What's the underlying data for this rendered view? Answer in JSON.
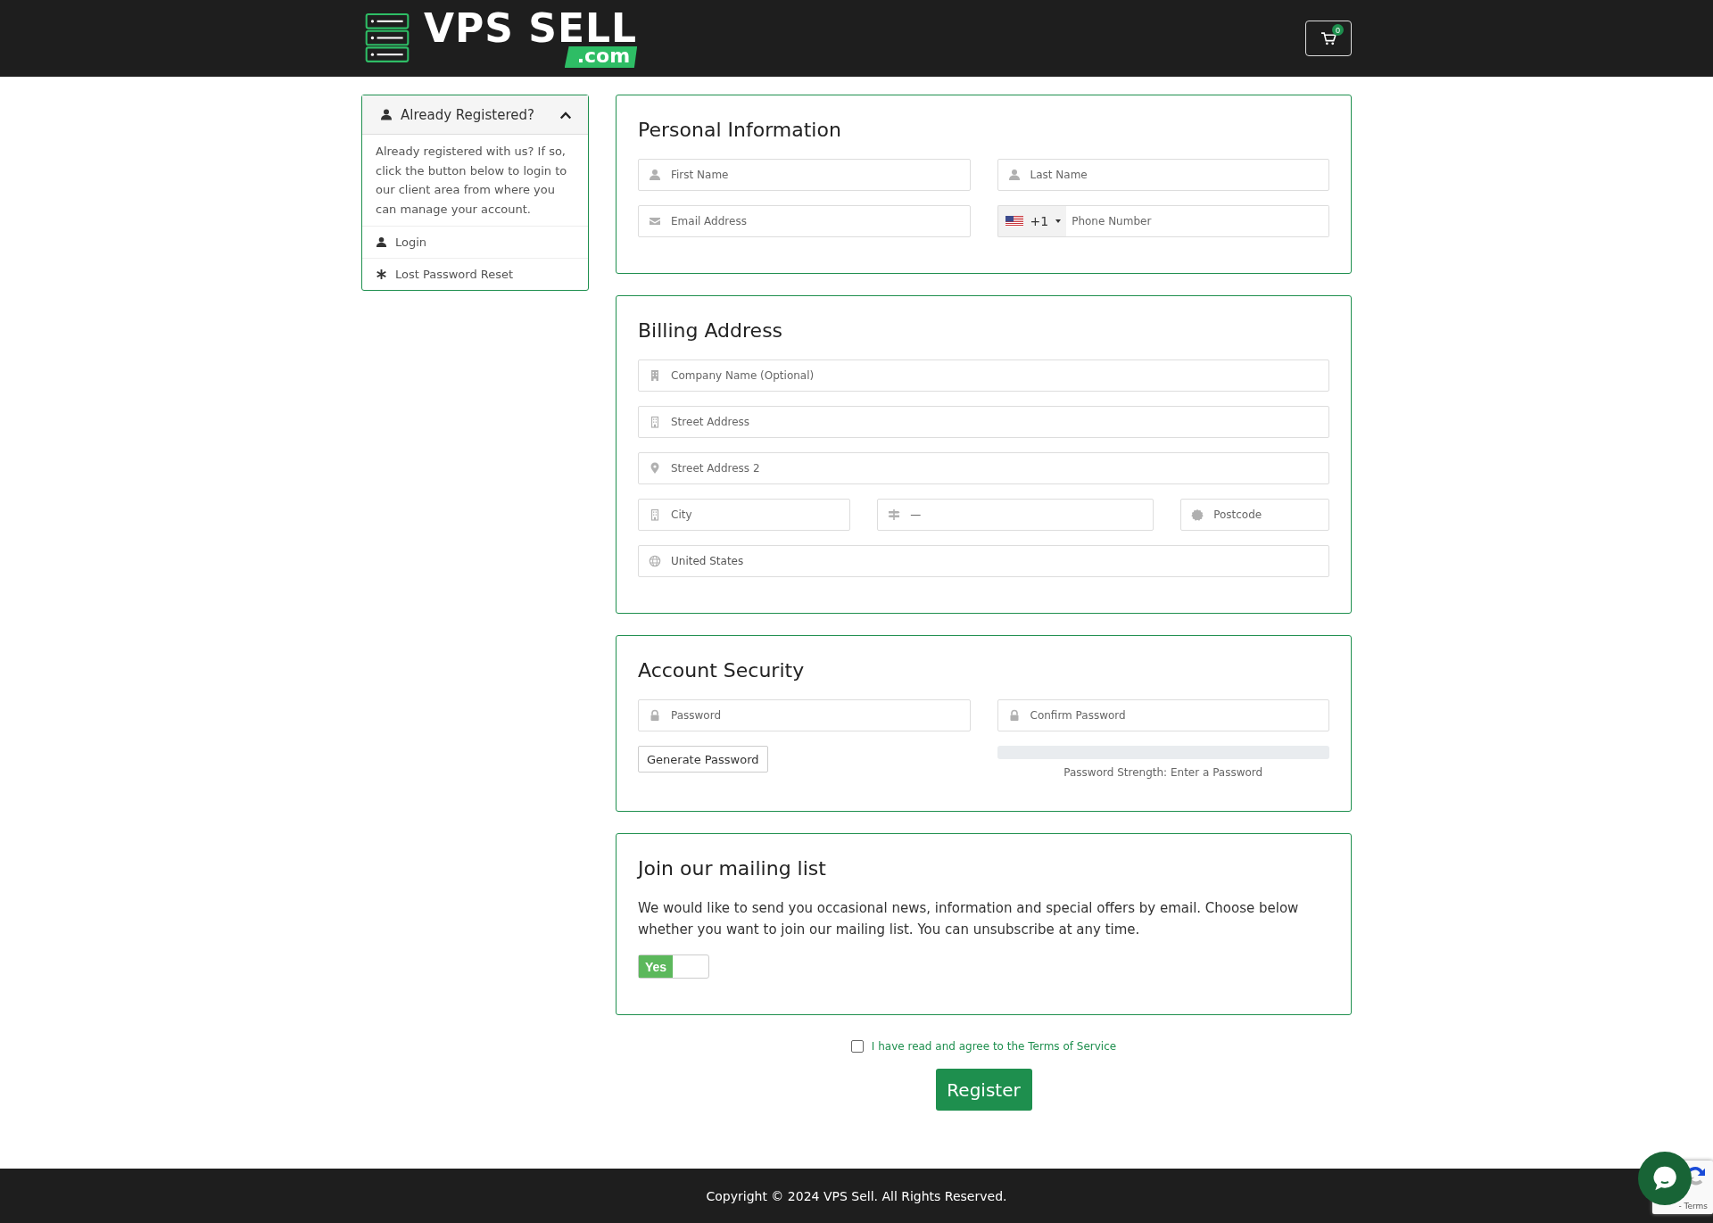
{
  "header": {
    "logo": {
      "name": "VPS SELL",
      "tld": ".com"
    },
    "cart": {
      "count": "0"
    }
  },
  "sidebar": {
    "title": "Already Registered?",
    "expanded": true,
    "body": "Already registered with us? If so, click the button below to login to our client area from where you can manage your account.",
    "links": [
      {
        "kind": "user",
        "label": "Login"
      },
      {
        "kind": "asterisk",
        "label": "Lost Password Reset"
      }
    ]
  },
  "personal_information": {
    "title": "Personal Information",
    "rows": [
      {
        "fields": [
          {
            "kind": "user",
            "placeholder": "First Name"
          },
          {
            "kind": "user",
            "placeholder": "Last Name"
          }
        ]
      },
      {
        "fields": [
          {
            "kind": "envelope",
            "placeholder": "Email Address"
          },
          {
            "kind": "phone",
            "country_code": "+1",
            "placeholder": "Phone Number"
          }
        ]
      }
    ]
  },
  "billing_address": {
    "title": "Billing Address",
    "rows": [
      {
        "fields": [
          {
            "kind": "building",
            "placeholder": "Company Name (Optional)"
          }
        ]
      },
      {
        "fields": [
          {
            "kind": "building-outline",
            "placeholder": "Street Address"
          }
        ]
      },
      {
        "fields": [
          {
            "kind": "map-marker",
            "placeholder": "Street Address 2"
          }
        ]
      },
      {
        "fields": [
          {
            "kind": "building-outline",
            "placeholder": "City"
          },
          {
            "kind": "signpost",
            "value": "—"
          },
          {
            "kind": "badge",
            "placeholder": "Postcode"
          }
        ]
      },
      {
        "fields": [
          {
            "kind": "globe",
            "value": "United States"
          }
        ]
      }
    ]
  },
  "account_security": {
    "title": "Account Security",
    "fields": [
      {
        "kind": "lock",
        "placeholder": "Password"
      },
      {
        "kind": "lock",
        "placeholder": "Confirm Password"
      }
    ],
    "generate_button": "Generate Password",
    "strength": {
      "text": "Password Strength: Enter a Password"
    }
  },
  "mailing_list": {
    "title": "Join our mailing list",
    "text": "We would like to send you occasional news, information and special offers by email. Choose below whether you want to join our mailing list. You can unsubscribe at any time.",
    "toggle": {
      "label": "Yes",
      "on": true
    }
  },
  "terms": {
    "checked": false,
    "label": "I have read and agree to the Terms of Service"
  },
  "register_button": "Register",
  "footer": {
    "copyright": "Copyright © 2024 VPS Sell. All Rights Reserved."
  },
  "recaptcha": {
    "text": "- Terms"
  }
}
